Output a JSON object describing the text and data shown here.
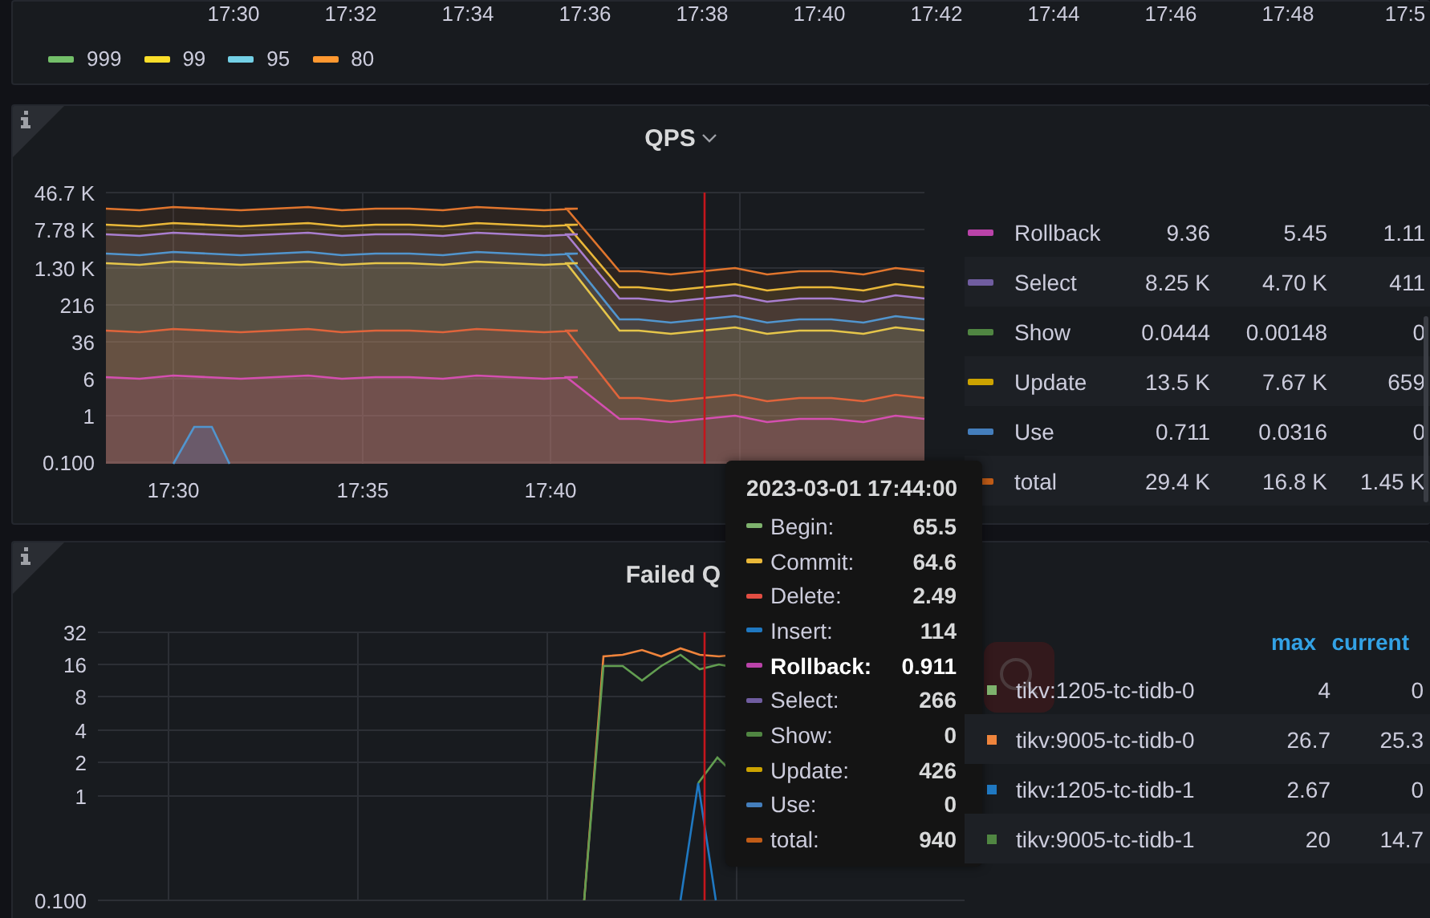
{
  "top_panel": {
    "x_axis_labels": [
      "17:30",
      "17:32",
      "17:34",
      "17:36",
      "17:38",
      "17:40",
      "17:42",
      "17:44",
      "17:46",
      "17:48",
      "17:5"
    ],
    "legend": [
      {
        "label": "999",
        "color": "#73bf69"
      },
      {
        "label": "99",
        "color": "#fade2a"
      },
      {
        "label": "95",
        "color": "#73d0e6"
      },
      {
        "label": "80",
        "color": "#ff9830"
      }
    ]
  },
  "qps_panel": {
    "title": "QPS",
    "y_axis_labels": [
      "46.7 K",
      "7.78 K",
      "1.30 K",
      "216",
      "36",
      "6",
      "1",
      "0.100"
    ],
    "x_axis_labels": [
      "17:30",
      "17:35",
      "17:40"
    ],
    "legend": [
      {
        "name": "Rollback",
        "color": "#ba43a9",
        "values": [
          "9.36",
          "5.45",
          "1.11"
        ]
      },
      {
        "name": "Select",
        "color": "#705da0",
        "values": [
          "8.25 K",
          "4.70 K",
          "411"
        ]
      },
      {
        "name": "Show",
        "color": "#508642",
        "values": [
          "0.0444",
          "0.00148",
          "0"
        ]
      },
      {
        "name": "Update",
        "color": "#cca300",
        "values": [
          "13.5 K",
          "7.67 K",
          "659"
        ]
      },
      {
        "name": "Use",
        "color": "#447ebc",
        "values": [
          "0.711",
          "0.0316",
          "0"
        ]
      },
      {
        "name": "total",
        "color": "#c15c17",
        "values": [
          "29.4 K",
          "16.8 K",
          "1.45 K"
        ]
      }
    ]
  },
  "failed_panel": {
    "title": "Failed Q",
    "y_axis_labels": [
      "32",
      "16",
      "8",
      "4",
      "2",
      "1",
      "0.100"
    ],
    "legend_columns": [
      "max",
      "current"
    ],
    "legend": [
      {
        "name": "tikv:1205-tc-tidb-0",
        "color": "#7eb26d",
        "values": [
          "4",
          "0"
        ]
      },
      {
        "name": "tikv:9005-tc-tidb-0",
        "color": "#ef843c",
        "values": [
          "26.7",
          "25.3"
        ]
      },
      {
        "name": "tikv:1205-tc-tidb-1",
        "color": "#1f78c1",
        "values": [
          "2.67",
          "0"
        ]
      },
      {
        "name": "tikv:9005-tc-tidb-1",
        "color": "#508642",
        "values": [
          "20",
          "14.7"
        ]
      }
    ]
  },
  "tooltip": {
    "time": "2023-03-01 17:44:00",
    "entries": [
      {
        "label": "Begin:",
        "value": "65.5",
        "color": "#7eb26d",
        "highlighted": false
      },
      {
        "label": "Commit:",
        "value": "64.6",
        "color": "#eab839",
        "highlighted": false
      },
      {
        "label": "Delete:",
        "value": "2.49",
        "color": "#e24d42",
        "highlighted": false
      },
      {
        "label": "Insert:",
        "value": "114",
        "color": "#1f78c1",
        "highlighted": false
      },
      {
        "label": "Rollback:",
        "value": "0.911",
        "color": "#ba43a9",
        "highlighted": true
      },
      {
        "label": "Select:",
        "value": "266",
        "color": "#705da0",
        "highlighted": false
      },
      {
        "label": "Show:",
        "value": "0",
        "color": "#508642",
        "highlighted": false
      },
      {
        "label": "Update:",
        "value": "426",
        "color": "#cca300",
        "highlighted": false
      },
      {
        "label": "Use:",
        "value": "0",
        "color": "#447ebc",
        "highlighted": false
      },
      {
        "label": "total:",
        "value": "940",
        "color": "#c15c17",
        "highlighted": false
      }
    ]
  }
}
